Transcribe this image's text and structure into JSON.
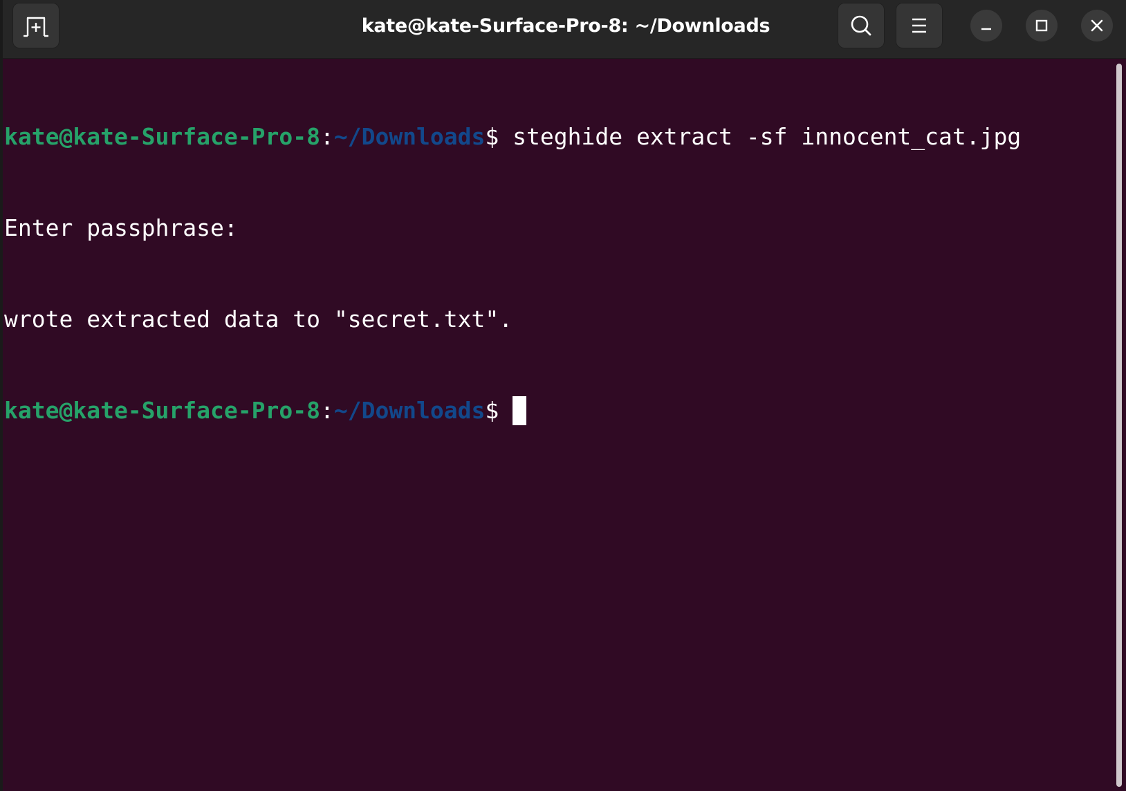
{
  "window": {
    "title": "kate@kate-Surface-Pro-8: ~/Downloads",
    "background_color": "#300a24",
    "titlebar_color": "#262626"
  },
  "titlebar": {
    "new_tab_icon": "new-tab-icon",
    "search_icon": "search-icon",
    "menu_icon": "hamburger-menu-icon",
    "minimize_icon": "minimize-icon",
    "maximize_icon": "maximize-icon",
    "close_icon": "close-icon"
  },
  "terminal": {
    "prompt_color_user": "#26a269",
    "prompt_color_path": "#12488b",
    "lines": [
      {
        "user_host": "kate@kate-Surface-Pro-8",
        "separator": ":",
        "path": "~/Downloads",
        "dollar": "$ ",
        "command": "steghide extract -sf innocent_cat.jpg"
      },
      {
        "output": "Enter passphrase:"
      },
      {
        "output": "wrote extracted data to \"secret.txt\"."
      },
      {
        "user_host": "kate@kate-Surface-Pro-8",
        "separator": ":",
        "path": "~/Downloads",
        "dollar": "$ ",
        "command": ""
      }
    ]
  }
}
